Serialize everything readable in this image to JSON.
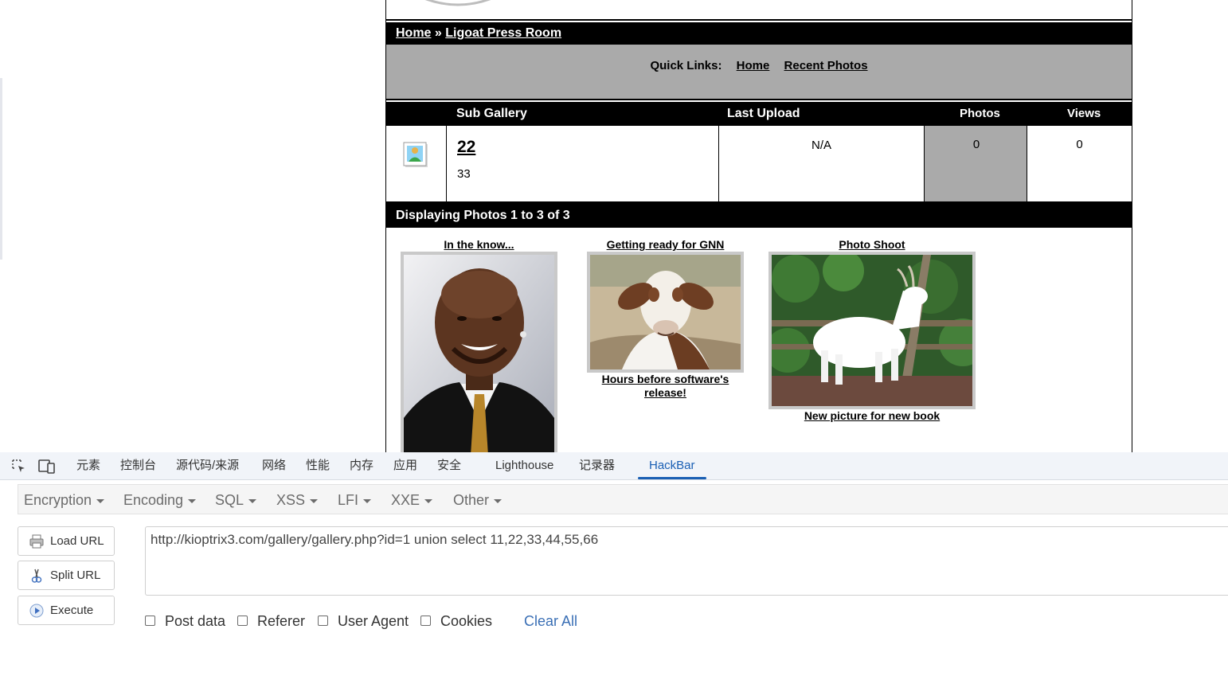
{
  "colors": {
    "accent": "#1a5fb4",
    "bar_black": "#000000",
    "quick_grey": "#aaaaaa"
  },
  "breadcrumb": {
    "home": "Home",
    "separator": " » ",
    "current": "Ligoat Press Room"
  },
  "quick_links": {
    "label": "Quick Links:",
    "home": "Home",
    "recent": "Recent Photos"
  },
  "gallery_table": {
    "headers": [
      "Sub Gallery",
      "Last Upload",
      "Photos",
      "Views"
    ],
    "row": {
      "name": "22",
      "desc": "33",
      "last_upload": "N/A",
      "photos": "0",
      "views": "0"
    }
  },
  "displaying": "Displaying Photos 1 to 3 of 3",
  "photos": [
    {
      "title": "In the know...",
      "caption": ""
    },
    {
      "title": "Getting ready for GNN",
      "caption": "Hours before software's release!"
    },
    {
      "title": "Photo Shoot",
      "caption": "New picture for new book"
    }
  ],
  "devtools": {
    "tabs": [
      "元素",
      "控制台",
      "源代码/来源",
      "网络",
      "性能",
      "内存",
      "应用",
      "安全",
      "Lighthouse",
      "记录器",
      "HackBar"
    ],
    "active_tab": "HackBar"
  },
  "hackbar": {
    "menus": [
      "Encryption",
      "Encoding",
      "SQL",
      "XSS",
      "LFI",
      "XXE",
      "Other"
    ],
    "buttons": {
      "load": "Load URL",
      "split": "Split URL",
      "execute": "Execute"
    },
    "url": "http://kioptrix3.com/gallery/gallery.php?id=1 union select 11,22,33,44,55,66",
    "checkboxes": [
      "Post data",
      "Referer",
      "User Agent",
      "Cookies"
    ],
    "clear_all": "Clear All"
  }
}
